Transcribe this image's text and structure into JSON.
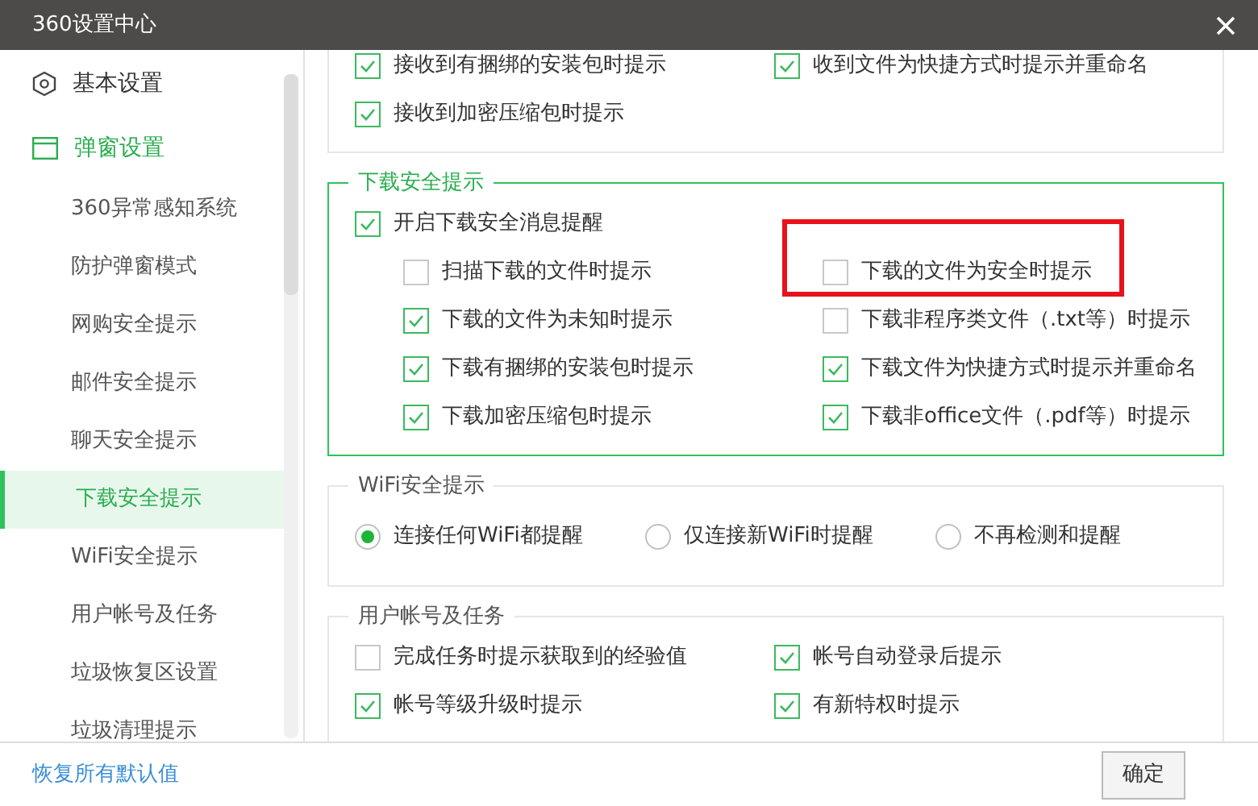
{
  "window": {
    "title": "360设置中心"
  },
  "sidebar": {
    "items": [
      {
        "label": "基本设置",
        "kind": "settings",
        "selected": false
      },
      {
        "label": "弹窗设置",
        "kind": "popup",
        "selected": true,
        "children": [
          {
            "label": "360异常感知系统",
            "selected": false
          },
          {
            "label": "防护弹窗模式",
            "selected": false
          },
          {
            "label": "网购安全提示",
            "selected": false
          },
          {
            "label": "邮件安全提示",
            "selected": false
          },
          {
            "label": "聊天安全提示",
            "selected": false
          },
          {
            "label": "下载安全提示",
            "selected": true
          },
          {
            "label": "WiFi安全提示",
            "selected": false
          },
          {
            "label": "用户帐号及任务",
            "selected": false
          },
          {
            "label": "垃圾恢复区设置",
            "selected": false
          },
          {
            "label": "垃圾清理提示",
            "selected": false
          }
        ]
      }
    ]
  },
  "sections": [
    {
      "kind": "checkboxes",
      "active": false,
      "items": [
        {
          "label": "接收到有捆绑的安装包时提示",
          "checked": true
        },
        {
          "label": "收到文件为快捷方式时提示并重命名",
          "checked": true
        },
        {
          "label": "接收到加密压缩包时提示",
          "checked": true
        }
      ]
    },
    {
      "kind": "checkboxes",
      "active": true,
      "title": "下载安全提示",
      "master": {
        "label": "开启下载安全消息提醒",
        "checked": true
      },
      "items": [
        {
          "label": "扫描下载的文件时提示",
          "checked": false,
          "highlighted": false
        },
        {
          "label": "下载的文件为安全时提示",
          "checked": false,
          "highlighted": true
        },
        {
          "label": "下载的文件为未知时提示",
          "checked": true,
          "highlighted": false
        },
        {
          "label": "下载非程序类文件（.txt等）时提示",
          "checked": false,
          "highlighted": false
        },
        {
          "label": "下载有捆绑的安装包时提示",
          "checked": true,
          "highlighted": false
        },
        {
          "label": "下载文件为快捷方式时提示并重命名",
          "checked": true,
          "highlighted": false
        },
        {
          "label": "下载加密压缩包时提示",
          "checked": true,
          "highlighted": false
        },
        {
          "label": "下载非office文件（.pdf等）时提示",
          "checked": true,
          "highlighted": false
        }
      ]
    },
    {
      "kind": "radios",
      "active": false,
      "title": "WiFi安全提示",
      "items": [
        {
          "label": "连接任何WiFi都提醒",
          "selected": true
        },
        {
          "label": "仅连接新WiFi时提醒",
          "selected": false
        },
        {
          "label": "不再检测和提醒",
          "selected": false
        }
      ]
    },
    {
      "kind": "checkboxes",
      "active": false,
      "title": "用户帐号及任务",
      "items": [
        {
          "label": "完成任务时提示获取到的经验值",
          "checked": false
        },
        {
          "label": "帐号自动登录后提示",
          "checked": true
        },
        {
          "label": "帐号等级升级时提示",
          "checked": true
        },
        {
          "label": "有新特权时提示",
          "checked": true
        }
      ]
    }
  ],
  "footer": {
    "reset_link": "恢复所有默认值",
    "ok_button": "确定"
  }
}
